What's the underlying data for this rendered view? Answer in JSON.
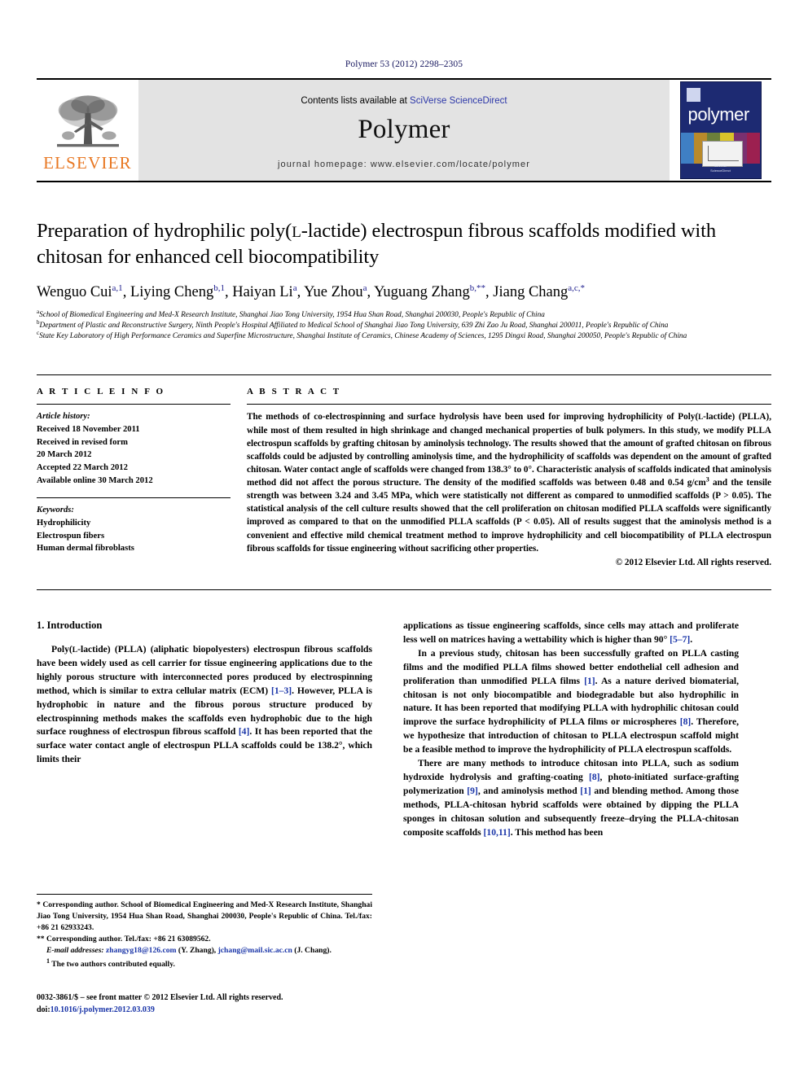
{
  "running_head": "Polymer 53 (2012) 2298–2305",
  "masthead": {
    "publisher_name": "ELSEVIER",
    "contents_prefix": "Contents lists available at ",
    "contents_link": "SciVerse ScienceDirect",
    "journal_title": "Polymer",
    "homepage": "journal homepage: www.elsevier.com/locate/polymer",
    "cover_word": "polymer",
    "cover_footer": "Polymer Science\nSciVerse ScienceDirect"
  },
  "article": {
    "title_line1": "Preparation of hydrophilic poly(",
    "title_smallcap": "L",
    "title_line1b": "-lactide) electrospun fibrous scaffolds modified",
    "title_line2": "with chitosan for enhanced cell biocompatibility",
    "authors": [
      {
        "name": "Wenguo Cui",
        "sup": "a,1",
        "sep": ", "
      },
      {
        "name": "Liying Cheng",
        "sup": "b,1",
        "sep": ", "
      },
      {
        "name": "Haiyan Li",
        "sup": "a",
        "sep": ", "
      },
      {
        "name": "Yue Zhou",
        "sup": "a",
        "sep": ", "
      },
      {
        "name": "Yuguang Zhang",
        "sup": "b,**",
        "sep": ", "
      },
      {
        "name": "Jiang Chang",
        "sup": "a,c,*",
        "sep": ""
      }
    ],
    "affiliations": [
      {
        "mark": "a",
        "text": "School of Biomedical Engineering and Med-X Research Institute, Shanghai Jiao Tong University, 1954 Hua Shan Road, Shanghai 200030, People's Republic of China"
      },
      {
        "mark": "b",
        "text": "Department of Plastic and Reconstructive Surgery, Ninth People's Hospital Affiliated to Medical School of Shanghai Jiao Tong University, 639 Zhi Zao Ju Road, Shanghai 200011, People's Republic of China"
      },
      {
        "mark": "c",
        "text": "State Key Laboratory of High Performance Ceramics and Superfine Microstructure, Shanghai Institute of Ceramics, Chinese Academy of Sciences, 1295 Dingxi Road, Shanghai 200050, People's Republic of China"
      }
    ]
  },
  "article_info": {
    "heading": "A R T I C L E   I N F O",
    "history_label": "Article history:",
    "history": [
      "Received 18 November 2011",
      "Received in revised form",
      "20 March 2012",
      "Accepted 22 March 2012",
      "Available online 30 March 2012"
    ],
    "keywords_label": "Keywords:",
    "keywords": [
      "Hydrophilicity",
      "Electrospun fibers",
      "Human dermal fibroblasts"
    ]
  },
  "abstract": {
    "heading": "A B S T R A C T",
    "text_part1": "The methods of co-electrospinning and surface hydrolysis have been used for improving hydrophilicity of Poly(",
    "text_smallcap": "L",
    "text_part2": "-lactide) (PLLA), while most of them resulted in high shrinkage and changed mechanical properties of bulk polymers. In this study, we modify PLLA electrospun scaffolds by grafting chitosan by aminolysis technology. The results showed that the amount of grafted chitosan on fibrous scaffolds could be adjusted by controlling aminolysis time, and the hydrophilicity of scaffolds was dependent on the amount of grafted chitosan. Water contact angle of scaffolds were changed from 138.3° to 0°. Characteristic analysis of scaffolds indicated that aminolysis method did not affect the porous structure. The density of the modified scaffolds was between 0.48 and 0.54 g/cm",
    "sup1": "3",
    "text_part3": " and the tensile strength was between 3.24 and 3.45 MPa, which were statistically not different as compared to unmodified scaffolds (P > 0.05). The statistical analysis of the cell culture results showed that the cell proliferation on chitosan modified PLLA scaffolds were significantly improved as compared to that on the unmodified PLLA scaffolds (P < 0.05). All of results suggest that the aminolysis method is a convenient and effective mild chemical treatment method to improve hydrophilicity and cell biocompatibility of PLLA electrospun fibrous scaffolds for tissue engineering without sacrificing other properties.",
    "copyright": "© 2012 Elsevier Ltd. All rights reserved."
  },
  "introduction": {
    "heading": "1. Introduction",
    "left_para1_a": "Poly(",
    "left_para1_smallcap": "L",
    "left_para1_b": "-lactide) (PLLA) (aliphatic biopolyesters) electrospun fibrous scaffolds have been widely used as cell carrier for tissue engineering applications due to the highly porous structure with interconnected pores produced by electrospinning method, which is similar to extra cellular matrix (ECM) ",
    "ref_1_3": "[1–3]",
    "left_para1_c": ". However, PLLA is hydrophobic in nature and the fibrous porous structure produced by electrospinning methods makes the scaffolds even hydrophobic due to the high surface roughness of electrospun fibrous scaffold ",
    "ref_4": "[4]",
    "left_para1_d": ". It has been reported that the surface water contact angle of electrospun PLLA scaffolds could be 138.2°, which limits their",
    "right_para1_a": "applications as tissue engineering scaffolds, since cells may attach and proliferate less well on matrices having a wettability which is higher than 90° ",
    "ref_5_7": "[5–7]",
    "right_para1_b": ".",
    "right_para2_a": "In a previous study, chitosan has been successfully grafted on PLLA casting films and the modified PLLA films showed better endothelial cell adhesion and proliferation than unmodified PLLA films ",
    "ref_1": "[1]",
    "right_para2_b": ". As a nature derived biomaterial, chitosan is not only biocompatible and biodegradable but also hydrophilic in nature. It has been reported that modifying PLLA with hydrophilic chitosan could improve the surface hydrophilicity of PLLA films or microspheres ",
    "ref_8": "[8]",
    "right_para2_c": ". Therefore, we hypothesize that introduction of chitosan to PLLA electrospun scaffold might be a feasible method to improve the hydrophilicity of PLLA electrospun scaffolds.",
    "right_para3_a": "There are many methods to introduce chitosan into PLLA, such as sodium hydroxide hydrolysis and grafting-coating ",
    "ref_8b": "[8]",
    "right_para3_b": ", photo-initiated surface-grafting polymerization ",
    "ref_9": "[9]",
    "right_para3_c": ", and aminolysis method ",
    "ref_1b": "[1]",
    "right_para3_d": " and blending method. Among those methods, PLLA-chitosan hybrid scaffolds were obtained by dipping the PLLA sponges in chitosan solution and subsequently freeze–drying the PLLA-chitosan composite scaffolds ",
    "ref_10_11": "[10,11]",
    "right_para3_e": ". This method has been"
  },
  "footnotes": {
    "corr1_mark": "*",
    "corr1_text": " Corresponding author. School of Biomedical Engineering and Med-X Research Institute, Shanghai Jiao Tong University, 1954 Hua Shan Road, Shanghai 200030, People's Republic of China. Tel./fax: +86 21 62933243.",
    "corr2_mark": "**",
    "corr2_text": " Corresponding author. Tel./fax: +86 21 63089562.",
    "email_label": "E-mail addresses:",
    "email1": "zhangyg18@126.com",
    "email1_owner": " (Y. Zhang), ",
    "email2": "jchang@mail.sic.ac.cn",
    "email2_owner": " (J. Chang).",
    "note1_mark": "1",
    "note1_text": " The two authors contributed equally."
  },
  "issn_block": {
    "line1": "0032-3861/$ – see front matter © 2012 Elsevier Ltd. All rights reserved.",
    "doi_label": "doi:",
    "doi": "10.1016/j.polymer.2012.03.039"
  },
  "colors": {
    "running_head": "#17175e",
    "link": "#2b36a8",
    "reference": "#1a35a8",
    "elsevier_orange": "#e87722",
    "masthead_bg": "#e3e3e3",
    "cover_bg": "#1d2a72"
  }
}
